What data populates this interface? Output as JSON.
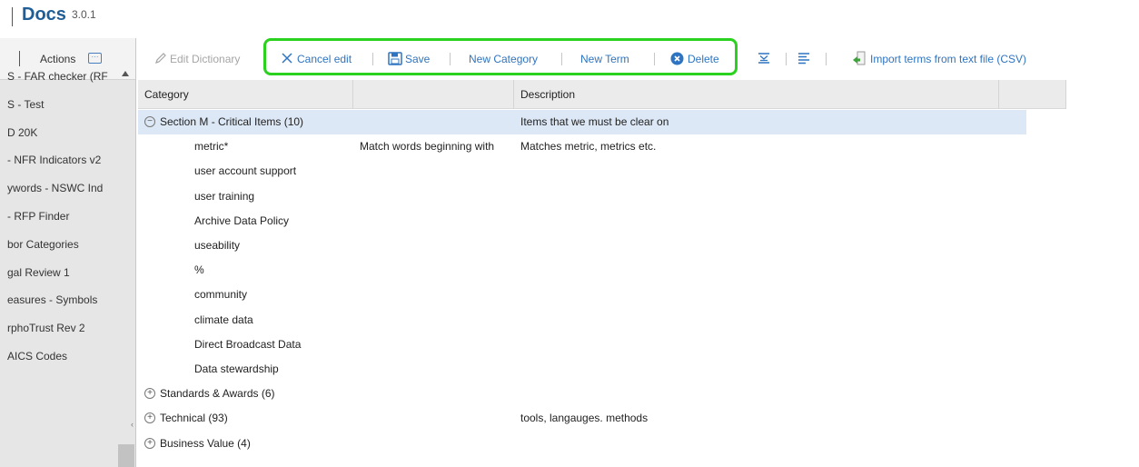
{
  "header": {
    "title": "Docs",
    "version": "3.0.1"
  },
  "sidebar": {
    "actions_label": "Actions",
    "items": [
      "S - FAR checker (RF",
      "S - Test",
      "D 20K",
      "- NFR Indicators v2",
      "ywords - NSWC Ind",
      "- RFP Finder",
      "bor Categories",
      "gal Review 1",
      "easures - Symbols",
      "rphoTrust Rev 2",
      "AICS Codes"
    ]
  },
  "toolbar": {
    "edit_dictionary": "Edit Dictionary",
    "cancel_edit": "Cancel edit",
    "save": "Save",
    "new_category": "New Category",
    "new_term": "New Term",
    "delete": "Delete",
    "import_terms": "Import terms from text file (CSV)"
  },
  "grid": {
    "headers": {
      "category": "Category",
      "col2": "",
      "description": "Description"
    },
    "rows": [
      {
        "type": "category",
        "expanded": true,
        "label": "Section M - Critical Items (10)",
        "col2": "",
        "description": "Items that we must be clear on"
      },
      {
        "type": "term",
        "label": "metric*",
        "col2": "Match words beginning with",
        "description": "Matches metric, metrics etc."
      },
      {
        "type": "term",
        "label": "user account support",
        "col2": "",
        "description": ""
      },
      {
        "type": "term",
        "label": "user training",
        "col2": "",
        "description": ""
      },
      {
        "type": "term",
        "label": "Archive Data Policy",
        "col2": "",
        "description": ""
      },
      {
        "type": "term",
        "label": "useability",
        "col2": "",
        "description": ""
      },
      {
        "type": "term",
        "label": "%",
        "col2": "",
        "description": ""
      },
      {
        "type": "term",
        "label": "community",
        "col2": "",
        "description": ""
      },
      {
        "type": "term",
        "label": "climate data",
        "col2": "",
        "description": ""
      },
      {
        "type": "term",
        "label": "Direct Broadcast Data",
        "col2": "",
        "description": ""
      },
      {
        "type": "term",
        "label": "Data stewardship",
        "col2": "",
        "description": ""
      },
      {
        "type": "category",
        "expanded": false,
        "label": "Standards & Awards (6)",
        "col2": "",
        "description": ""
      },
      {
        "type": "category",
        "expanded": false,
        "label": "Technical (93)",
        "col2": "",
        "description": "tools, langauges. methods"
      },
      {
        "type": "category",
        "expanded": false,
        "label": "Business Value (4)",
        "col2": "",
        "description": ""
      }
    ]
  },
  "colors": {
    "accent": "#2f74c0",
    "highlight_box": "#2bd11f",
    "selected_row": "#dde8f6"
  }
}
